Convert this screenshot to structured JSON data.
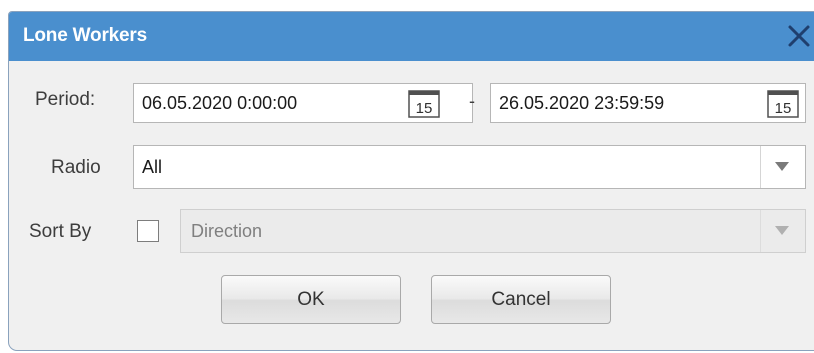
{
  "dialog": {
    "title": "Lone Workers",
    "title_bar_color": "#4a8fce",
    "close_icon": "close-icon"
  },
  "period": {
    "label": "Period:",
    "start_value": "06.05.2020 0:00:00",
    "separator": "-",
    "end_value": "26.05.2020 23:59:59",
    "calendar_icon": "calendar-icon",
    "calendar_day": "15"
  },
  "radio": {
    "label": "Radio",
    "selected": "All"
  },
  "sort_by": {
    "label": "Sort By",
    "checked": false,
    "selected": "Direction"
  },
  "buttons": {
    "ok_label": "OK",
    "cancel_label": "Cancel"
  }
}
